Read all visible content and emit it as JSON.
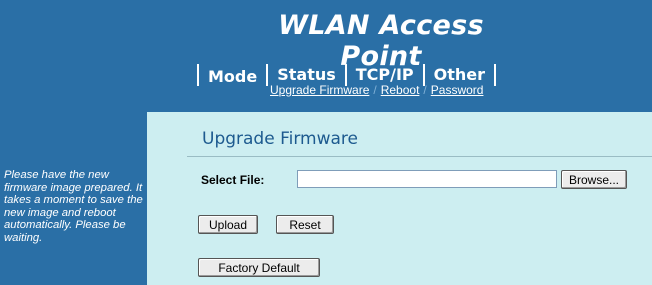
{
  "header": {
    "title": "WLAN Access Point",
    "tabs": [
      {
        "label": "Mode"
      },
      {
        "label": "Status"
      },
      {
        "label": "TCP/IP"
      },
      {
        "label": "Other"
      }
    ],
    "subnav": [
      {
        "label": "Upgrade Firmware"
      },
      {
        "label": "Reboot"
      },
      {
        "label": "Password"
      }
    ],
    "subnav_separator": "/"
  },
  "sidebar": {
    "help_text": "Please have the new firmware image prepared. It takes a moment to save the new image and reboot automatically. Please be waiting."
  },
  "main": {
    "page_title": "Upgrade Firmware",
    "select_file_label": "Select File:",
    "file_value": "",
    "browse_label": "Browse...",
    "upload_label": "Upload",
    "reset_label": "Reset",
    "factory_default_label": "Factory Default"
  },
  "colors": {
    "header_bg": "#2a6fa6",
    "content_bg": "#cdeef1",
    "title_color": "#1d5a8f"
  }
}
